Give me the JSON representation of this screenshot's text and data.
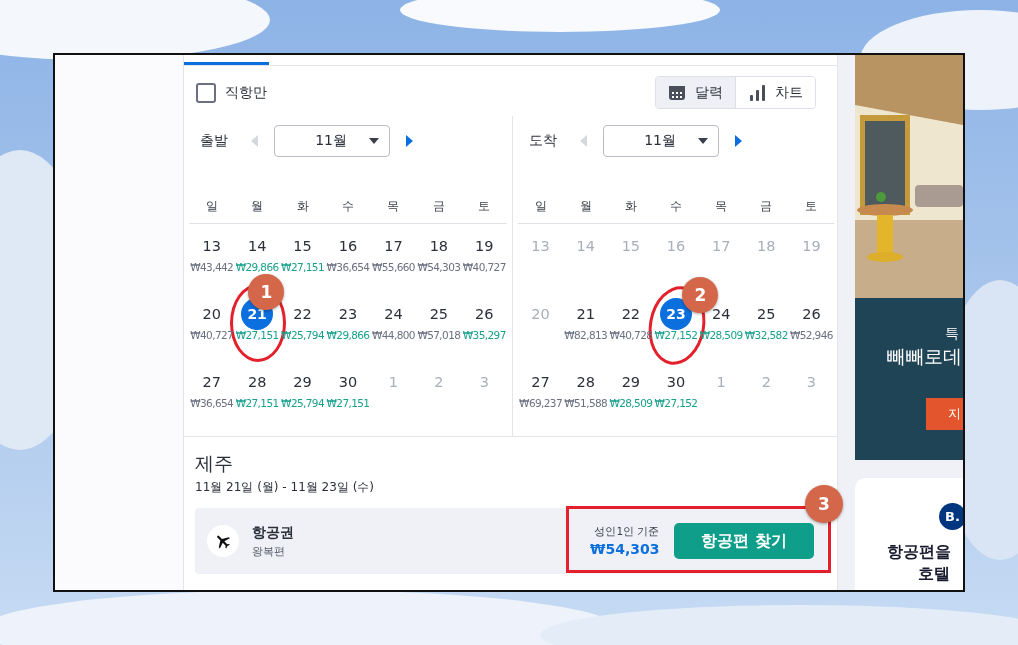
{
  "filter": {
    "label": "직항만",
    "checked": false
  },
  "view_toggle": [
    {
      "label": "달력",
      "selected": true
    },
    {
      "label": "차트",
      "selected": false
    }
  ],
  "calendars": [
    {
      "label": "출발",
      "month": "11월",
      "weekdays": [
        "일",
        "월",
        "화",
        "수",
        "목",
        "금",
        "토"
      ],
      "prev_disabled": true,
      "next_disabled": false,
      "weeks": [
        [
          {
            "day": "13",
            "price": "₩43,442",
            "cheap": false,
            "muted": false,
            "selected": false
          },
          {
            "day": "14",
            "price": "₩29,866",
            "cheap": true,
            "muted": false,
            "selected": false
          },
          {
            "day": "15",
            "price": "₩27,151",
            "cheap": true,
            "muted": false,
            "selected": false
          },
          {
            "day": "16",
            "price": "₩36,654",
            "cheap": false,
            "muted": false,
            "selected": false
          },
          {
            "day": "17",
            "price": "₩55,660",
            "cheap": false,
            "muted": false,
            "selected": false
          },
          {
            "day": "18",
            "price": "₩54,303",
            "cheap": false,
            "muted": false,
            "selected": false
          },
          {
            "day": "19",
            "price": "₩40,727",
            "cheap": false,
            "muted": false,
            "selected": false
          }
        ],
        [
          {
            "day": "20",
            "price": "₩40,727",
            "cheap": false,
            "muted": false,
            "selected": false
          },
          {
            "day": "21",
            "price": "₩27,151",
            "cheap": true,
            "muted": false,
            "selected": true,
            "annotation": "1"
          },
          {
            "day": "22",
            "price": "₩25,794",
            "cheap": true,
            "muted": false,
            "selected": false
          },
          {
            "day": "23",
            "price": "₩29,866",
            "cheap": true,
            "muted": false,
            "selected": false
          },
          {
            "day": "24",
            "price": "₩44,800",
            "cheap": false,
            "muted": false,
            "selected": false
          },
          {
            "day": "25",
            "price": "₩57,018",
            "cheap": false,
            "muted": false,
            "selected": false
          },
          {
            "day": "26",
            "price": "₩35,297",
            "cheap": true,
            "muted": false,
            "selected": false
          }
        ],
        [
          {
            "day": "27",
            "price": "₩36,654",
            "cheap": false,
            "muted": false,
            "selected": false
          },
          {
            "day": "28",
            "price": "₩27,151",
            "cheap": true,
            "muted": false,
            "selected": false
          },
          {
            "day": "29",
            "price": "₩25,794",
            "cheap": true,
            "muted": false,
            "selected": false
          },
          {
            "day": "30",
            "price": "₩27,151",
            "cheap": true,
            "muted": false,
            "selected": false
          },
          {
            "day": "1",
            "muted": true,
            "selected": false
          },
          {
            "day": "2",
            "muted": true,
            "selected": false
          },
          {
            "day": "3",
            "muted": true,
            "selected": false
          }
        ]
      ]
    },
    {
      "label": "도착",
      "month": "11월",
      "weekdays": [
        "일",
        "월",
        "화",
        "수",
        "목",
        "금",
        "토"
      ],
      "prev_disabled": true,
      "next_disabled": false,
      "weeks": [
        [
          {
            "day": "13",
            "muted": true,
            "selected": false
          },
          {
            "day": "14",
            "muted": true,
            "selected": false
          },
          {
            "day": "15",
            "muted": true,
            "selected": false
          },
          {
            "day": "16",
            "muted": true,
            "selected": false
          },
          {
            "day": "17",
            "muted": true,
            "selected": false
          },
          {
            "day": "18",
            "muted": true,
            "selected": false
          },
          {
            "day": "19",
            "muted": true,
            "selected": false
          }
        ],
        [
          {
            "day": "20",
            "muted": true,
            "selected": false
          },
          {
            "day": "21",
            "price": "₩82,813",
            "cheap": false,
            "muted": false,
            "selected": false
          },
          {
            "day": "22",
            "price": "₩40,728",
            "cheap": false,
            "muted": false,
            "selected": false
          },
          {
            "day": "23",
            "price": "₩27,152",
            "cheap": true,
            "muted": false,
            "selected": true,
            "annotation": "2"
          },
          {
            "day": "24",
            "price": "₩28,509",
            "cheap": true,
            "muted": false,
            "selected": false
          },
          {
            "day": "25",
            "price": "₩32,582",
            "cheap": true,
            "muted": false,
            "selected": false
          },
          {
            "day": "26",
            "price": "₩52,946",
            "cheap": false,
            "muted": false,
            "selected": false
          }
        ],
        [
          {
            "day": "27",
            "price": "₩69,237",
            "cheap": false,
            "muted": false,
            "selected": false
          },
          {
            "day": "28",
            "price": "₩51,588",
            "cheap": false,
            "muted": false,
            "selected": false
          },
          {
            "day": "29",
            "price": "₩28,509",
            "cheap": true,
            "muted": false,
            "selected": false
          },
          {
            "day": "30",
            "price": "₩27,152",
            "cheap": true,
            "muted": false,
            "selected": false
          },
          {
            "day": "1",
            "muted": true,
            "selected": false
          },
          {
            "day": "2",
            "muted": true,
            "selected": false
          },
          {
            "day": "3",
            "muted": true,
            "selected": false
          }
        ]
      ]
    }
  ],
  "summary": {
    "destination": "제주",
    "dates": "11월 21일 (월) - 11월 23일 (수)"
  },
  "flight_bar": {
    "title": "항공권",
    "subtitle": "왕복편",
    "price_note": "성인1인 기준",
    "price": "₩54,303",
    "button": "항공편 찾기",
    "annotation": "3"
  },
  "ad": {
    "kind": "picture",
    "eyebrow": "특",
    "headline": "빼빼로데",
    "cta": "지"
  },
  "promo_card": {
    "logo_text": "B.",
    "lines": [
      "항공편을",
      "호텔"
    ]
  }
}
